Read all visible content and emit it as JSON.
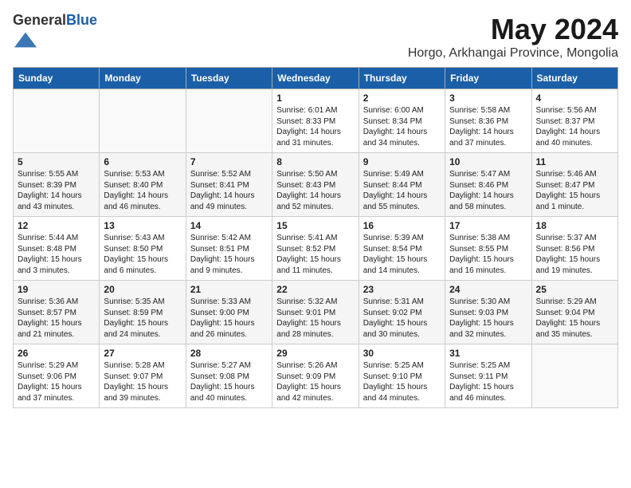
{
  "header": {
    "logo_general": "General",
    "logo_blue": "Blue",
    "month_title": "May 2024",
    "location": "Horgo, Arkhangai Province, Mongolia"
  },
  "weekdays": [
    "Sunday",
    "Monday",
    "Tuesday",
    "Wednesday",
    "Thursday",
    "Friday",
    "Saturday"
  ],
  "weeks": [
    [
      {
        "day": "",
        "info": ""
      },
      {
        "day": "",
        "info": ""
      },
      {
        "day": "",
        "info": ""
      },
      {
        "day": "1",
        "info": "Sunrise: 6:01 AM\nSunset: 8:33 PM\nDaylight: 14 hours\nand 31 minutes."
      },
      {
        "day": "2",
        "info": "Sunrise: 6:00 AM\nSunset: 8:34 PM\nDaylight: 14 hours\nand 34 minutes."
      },
      {
        "day": "3",
        "info": "Sunrise: 5:58 AM\nSunset: 8:36 PM\nDaylight: 14 hours\nand 37 minutes."
      },
      {
        "day": "4",
        "info": "Sunrise: 5:56 AM\nSunset: 8:37 PM\nDaylight: 14 hours\nand 40 minutes."
      }
    ],
    [
      {
        "day": "5",
        "info": "Sunrise: 5:55 AM\nSunset: 8:39 PM\nDaylight: 14 hours\nand 43 minutes."
      },
      {
        "day": "6",
        "info": "Sunrise: 5:53 AM\nSunset: 8:40 PM\nDaylight: 14 hours\nand 46 minutes."
      },
      {
        "day": "7",
        "info": "Sunrise: 5:52 AM\nSunset: 8:41 PM\nDaylight: 14 hours\nand 49 minutes."
      },
      {
        "day": "8",
        "info": "Sunrise: 5:50 AM\nSunset: 8:43 PM\nDaylight: 14 hours\nand 52 minutes."
      },
      {
        "day": "9",
        "info": "Sunrise: 5:49 AM\nSunset: 8:44 PM\nDaylight: 14 hours\nand 55 minutes."
      },
      {
        "day": "10",
        "info": "Sunrise: 5:47 AM\nSunset: 8:46 PM\nDaylight: 14 hours\nand 58 minutes."
      },
      {
        "day": "11",
        "info": "Sunrise: 5:46 AM\nSunset: 8:47 PM\nDaylight: 15 hours\nand 1 minute."
      }
    ],
    [
      {
        "day": "12",
        "info": "Sunrise: 5:44 AM\nSunset: 8:48 PM\nDaylight: 15 hours\nand 3 minutes."
      },
      {
        "day": "13",
        "info": "Sunrise: 5:43 AM\nSunset: 8:50 PM\nDaylight: 15 hours\nand 6 minutes."
      },
      {
        "day": "14",
        "info": "Sunrise: 5:42 AM\nSunset: 8:51 PM\nDaylight: 15 hours\nand 9 minutes."
      },
      {
        "day": "15",
        "info": "Sunrise: 5:41 AM\nSunset: 8:52 PM\nDaylight: 15 hours\nand 11 minutes."
      },
      {
        "day": "16",
        "info": "Sunrise: 5:39 AM\nSunset: 8:54 PM\nDaylight: 15 hours\nand 14 minutes."
      },
      {
        "day": "17",
        "info": "Sunrise: 5:38 AM\nSunset: 8:55 PM\nDaylight: 15 hours\nand 16 minutes."
      },
      {
        "day": "18",
        "info": "Sunrise: 5:37 AM\nSunset: 8:56 PM\nDaylight: 15 hours\nand 19 minutes."
      }
    ],
    [
      {
        "day": "19",
        "info": "Sunrise: 5:36 AM\nSunset: 8:57 PM\nDaylight: 15 hours\nand 21 minutes."
      },
      {
        "day": "20",
        "info": "Sunrise: 5:35 AM\nSunset: 8:59 PM\nDaylight: 15 hours\nand 24 minutes."
      },
      {
        "day": "21",
        "info": "Sunrise: 5:33 AM\nSunset: 9:00 PM\nDaylight: 15 hours\nand 26 minutes."
      },
      {
        "day": "22",
        "info": "Sunrise: 5:32 AM\nSunset: 9:01 PM\nDaylight: 15 hours\nand 28 minutes."
      },
      {
        "day": "23",
        "info": "Sunrise: 5:31 AM\nSunset: 9:02 PM\nDaylight: 15 hours\nand 30 minutes."
      },
      {
        "day": "24",
        "info": "Sunrise: 5:30 AM\nSunset: 9:03 PM\nDaylight: 15 hours\nand 32 minutes."
      },
      {
        "day": "25",
        "info": "Sunrise: 5:29 AM\nSunset: 9:04 PM\nDaylight: 15 hours\nand 35 minutes."
      }
    ],
    [
      {
        "day": "26",
        "info": "Sunrise: 5:29 AM\nSunset: 9:06 PM\nDaylight: 15 hours\nand 37 minutes."
      },
      {
        "day": "27",
        "info": "Sunrise: 5:28 AM\nSunset: 9:07 PM\nDaylight: 15 hours\nand 39 minutes."
      },
      {
        "day": "28",
        "info": "Sunrise: 5:27 AM\nSunset: 9:08 PM\nDaylight: 15 hours\nand 40 minutes."
      },
      {
        "day": "29",
        "info": "Sunrise: 5:26 AM\nSunset: 9:09 PM\nDaylight: 15 hours\nand 42 minutes."
      },
      {
        "day": "30",
        "info": "Sunrise: 5:25 AM\nSunset: 9:10 PM\nDaylight: 15 hours\nand 44 minutes."
      },
      {
        "day": "31",
        "info": "Sunrise: 5:25 AM\nSunset: 9:11 PM\nDaylight: 15 hours\nand 46 minutes."
      },
      {
        "day": "",
        "info": ""
      }
    ]
  ]
}
